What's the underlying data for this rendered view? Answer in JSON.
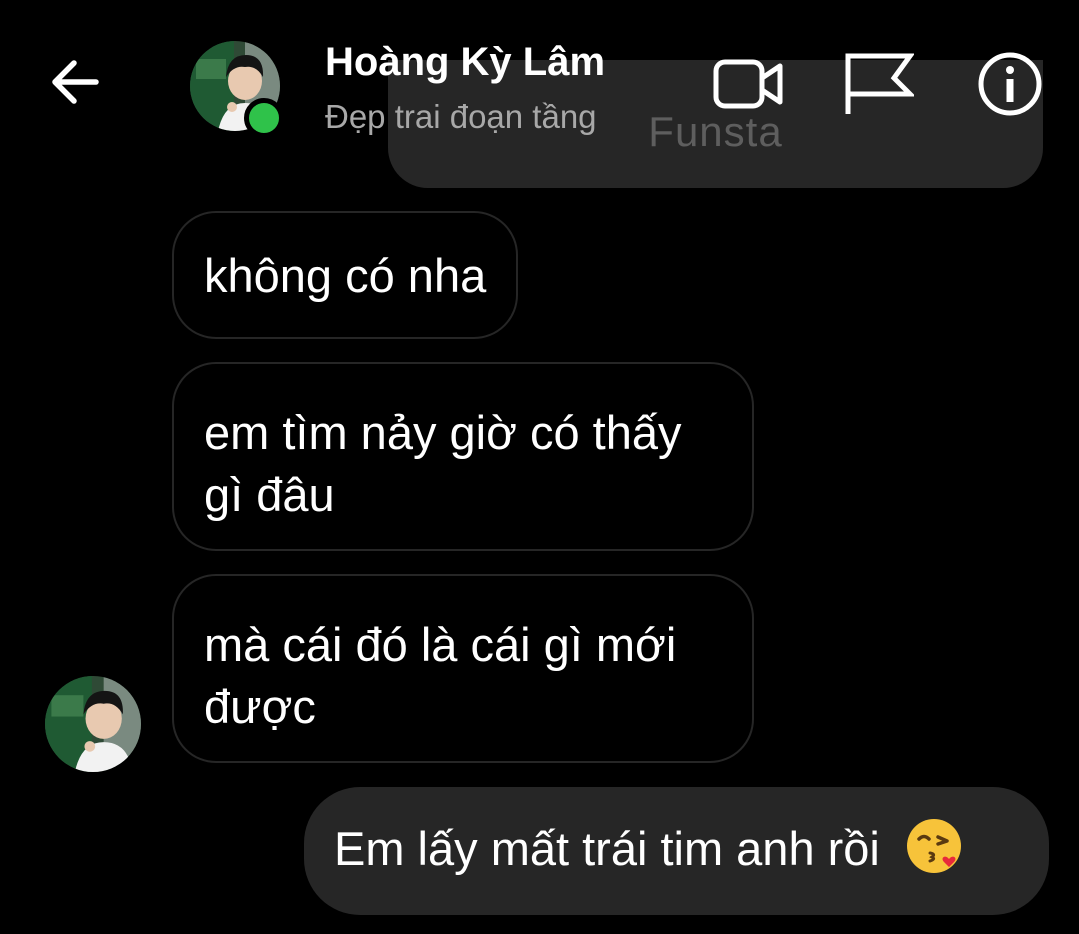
{
  "header": {
    "contact_name": "Hoàng Kỳ Lâm",
    "contact_status": "Đẹp trai đoạn tầng",
    "icons": [
      "back-arrow-icon",
      "video-call-icon",
      "flag-icon",
      "info-icon"
    ]
  },
  "previous_bubble_fragment": "Funsta",
  "messages": [
    {
      "direction": "incoming",
      "text": "không có nha"
    },
    {
      "direction": "incoming",
      "lines": [
        "em tìm nảy giờ có thấy",
        "gì đâu"
      ]
    },
    {
      "direction": "incoming",
      "lines": [
        "mà cái đó là cái gì mới",
        "được"
      ]
    },
    {
      "direction": "outgoing",
      "text": "Em lấy mất trái tim anh rồi",
      "emoji": "face-blowing-kiss"
    }
  ],
  "colors": {
    "background": "#000000",
    "outgoing_bubble": "#262626",
    "incoming_border": "#262626",
    "online": "#2fc24a",
    "status_text": "#a8a8a8"
  }
}
